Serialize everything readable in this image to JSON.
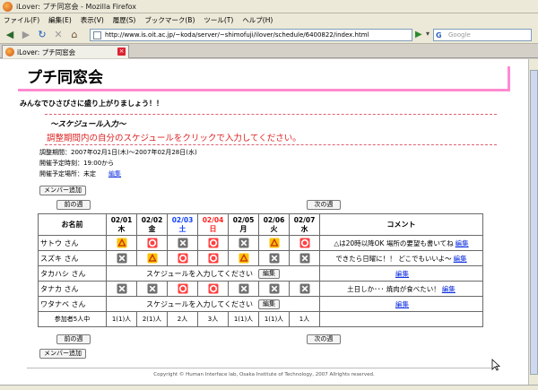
{
  "window": {
    "title": "iLover: プチ同窓会 - Mozilla Firefox"
  },
  "menu": [
    "ファイル(F)",
    "編集(E)",
    "表示(V)",
    "履歴(S)",
    "ブックマーク(B)",
    "ツール(T)",
    "ヘルプ(H)"
  ],
  "address": {
    "url": "http://www.is.oit.ac.jp/~koda/server/~shimofuji/ilover/schedule/6400822/index.html"
  },
  "search": {
    "placeholder": "Google"
  },
  "tab": {
    "label": "iLover: プチ同窓会"
  },
  "page": {
    "title": "プチ同窓会",
    "tagline": "みんなでひさびさに盛り上がりましょう！！",
    "schedule_heading": "～スケジュール入力～",
    "notice": "調整期間内の自分のスケジュールをクリックで入力してください。",
    "period": "調整期間：2007年02月1日(木)～2007年02月28日(水)",
    "time": "開催予定時刻：19:00から",
    "place": "開催予定場所：未定",
    "place_edit": "編集",
    "add_member": "メンバー追加",
    "prev_week": "前の週",
    "next_week": "次の週",
    "footer": "Copyright © Human Interface lab, Osaka Institute of Technology, 2007 Allrights reserved."
  },
  "table": {
    "name_header": "お名前",
    "comment_header": "コメント",
    "days": [
      {
        "date": "02/01",
        "dow": "木",
        "color": "#000000"
      },
      {
        "date": "02/02",
        "dow": "金",
        "color": "#000000"
      },
      {
        "date": "02/03",
        "dow": "土",
        "color": "#1040ff"
      },
      {
        "date": "02/04",
        "dow": "日",
        "color": "#ff2020"
      },
      {
        "date": "02/05",
        "dow": "月",
        "color": "#000000"
      },
      {
        "date": "02/06",
        "dow": "火",
        "color": "#000000"
      },
      {
        "date": "02/07",
        "dow": "水",
        "color": "#000000"
      }
    ],
    "rows": [
      {
        "name": "サトウ さん",
        "marks": [
          "triangle",
          "circle",
          "cross",
          "circle",
          "cross",
          "triangle",
          "circle"
        ],
        "comment": "△は20時以降OK 場所の要望も書いてね",
        "edit": "編集"
      },
      {
        "name": "スズキ さん",
        "marks": [
          "cross",
          "triangle",
          "circle",
          "circle",
          "triangle",
          "cross",
          "cross"
        ],
        "comment": "できたら日曜に！！ どこでもいいよ～",
        "edit": "編集"
      },
      {
        "name": "タカハシ さん",
        "pending": "スケジュールを入力してください",
        "pending_edit": "編集",
        "comment": "",
        "edit": "編集"
      },
      {
        "name": "タナカ さん",
        "marks": [
          "cross",
          "cross",
          "circle",
          "circle",
          "cross",
          "cross",
          "cross"
        ],
        "comment": "土日しか･･･ 焼肉が食べたい！",
        "edit": "編集"
      },
      {
        "name": "ワタナベ さん",
        "pending": "スケジュールを入力してください",
        "pending_edit": "編集",
        "comment": "",
        "edit": "編集"
      }
    ],
    "totals_label": "参加者5人中",
    "totals": [
      "1(1)人",
      "2(1)人",
      "2人",
      "3人",
      "1(1)人",
      "1(1)人",
      "1人"
    ]
  },
  "icon_colors": {
    "circle": "#ff4040",
    "triangle": "#ffc000",
    "cross": "#707070"
  }
}
